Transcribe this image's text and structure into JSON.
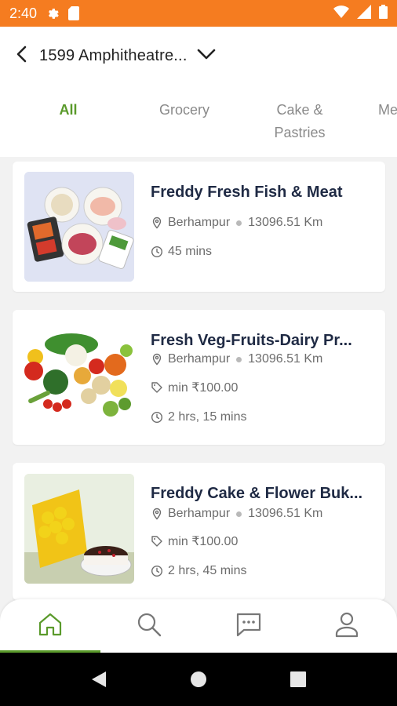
{
  "status_bar": {
    "time": "2:40",
    "icons": [
      "settings-icon",
      "sd-card-icon",
      "wifi-icon",
      "signal-icon",
      "battery-icon"
    ]
  },
  "header": {
    "address": "1599 Amphitheatre...",
    "icons": [
      "back-arrow-icon",
      "chevron-down-icon"
    ]
  },
  "tabs": [
    {
      "label": "All",
      "active": true
    },
    {
      "label": "Grocery",
      "active": false
    },
    {
      "label": "Cake &",
      "label2": "Pastries",
      "active": false
    },
    {
      "label": "Me",
      "active": false
    }
  ],
  "stores": [
    {
      "name": "Freddy Fresh Fish & Meat",
      "location": "Berhampur",
      "distance": "13096.51 Km",
      "min_order": "",
      "delivery_time": "45 mins",
      "image": "fish-meat-platter"
    },
    {
      "name": "Fresh Veg-Fruits-Dairy Pr...",
      "location": "Berhampur",
      "distance": "13096.51 Km",
      "min_order": "min ₹100.00",
      "delivery_time": "2 hrs, 15 mins",
      "image": "vegetables-fruits"
    },
    {
      "name": "Freddy Cake & Flower Buk...",
      "location": "Berhampur",
      "distance": "13096.51 Km",
      "min_order": "min ₹100.00",
      "delivery_time": "2 hrs, 45 mins",
      "image": "flowers-cake"
    }
  ],
  "bottom_nav": {
    "items": [
      "home-icon",
      "search-icon",
      "chat-icon",
      "profile-icon"
    ],
    "active_index": 0
  },
  "colors": {
    "accent": "#5a9a2b",
    "status_bar": "#f57c20",
    "title": "#1f2a44"
  }
}
